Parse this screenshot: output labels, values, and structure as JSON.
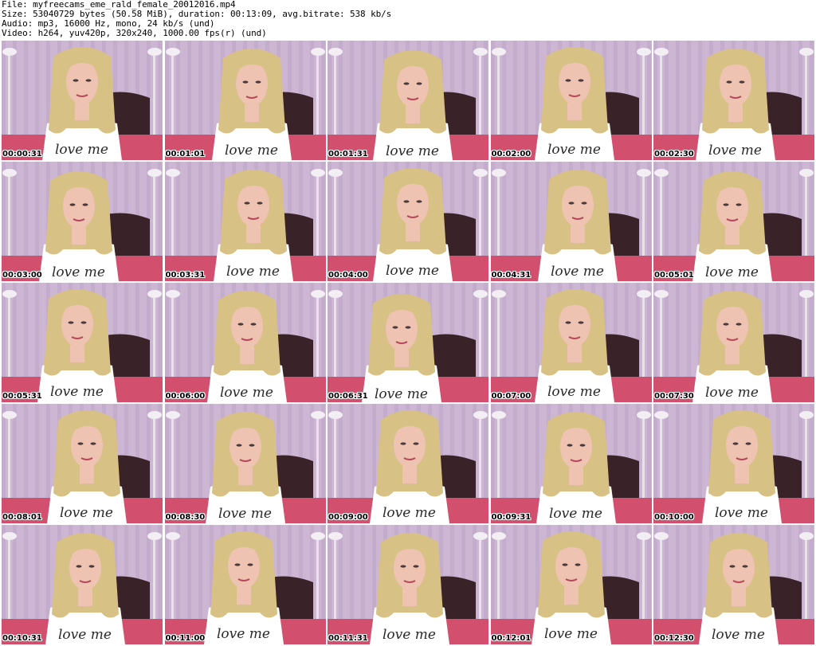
{
  "header": {
    "file_line": "File: myfreecams_eme_rald_female_20012016.mp4",
    "size_line": "Size: 53040729 bytes (50.58 MiB), duration: 00:13:09, avg.bitrate: 538 kb/s",
    "audio_line": "Audio: mp3, 16000 Hz, mono, 24 kb/s (und)",
    "video_line": "Video: h264, yuv420p, 320x240, 1000.00 fps(r) (und)"
  },
  "thumbnails": [
    {
      "timestamp": "00:00:31"
    },
    {
      "timestamp": "00:01:01"
    },
    {
      "timestamp": "00:01:31"
    },
    {
      "timestamp": "00:02:00"
    },
    {
      "timestamp": "00:02:30"
    },
    {
      "timestamp": "00:03:00"
    },
    {
      "timestamp": "00:03:31"
    },
    {
      "timestamp": "00:04:00"
    },
    {
      "timestamp": "00:04:31"
    },
    {
      "timestamp": "00:05:01"
    },
    {
      "timestamp": "00:05:31"
    },
    {
      "timestamp": "00:06:00"
    },
    {
      "timestamp": "00:06:31"
    },
    {
      "timestamp": "00:07:00"
    },
    {
      "timestamp": "00:07:30"
    },
    {
      "timestamp": "00:08:01"
    },
    {
      "timestamp": "00:08:30"
    },
    {
      "timestamp": "00:09:00"
    },
    {
      "timestamp": "00:09:31"
    },
    {
      "timestamp": "00:10:00"
    },
    {
      "timestamp": "00:10:31"
    },
    {
      "timestamp": "00:11:00"
    },
    {
      "timestamp": "00:11:31"
    },
    {
      "timestamp": "00:12:01"
    },
    {
      "timestamp": "00:12:30"
    }
  ],
  "thumbnail_shirt_text": "love me",
  "colors": {
    "wall": "#cdb6d3",
    "wall_stripe": "#bda4c6",
    "hair": "#d7c184",
    "skin": "#eec3b2",
    "shirt": "#ffffff",
    "bed": "#d24f6d",
    "headboard": "#3a2229"
  }
}
